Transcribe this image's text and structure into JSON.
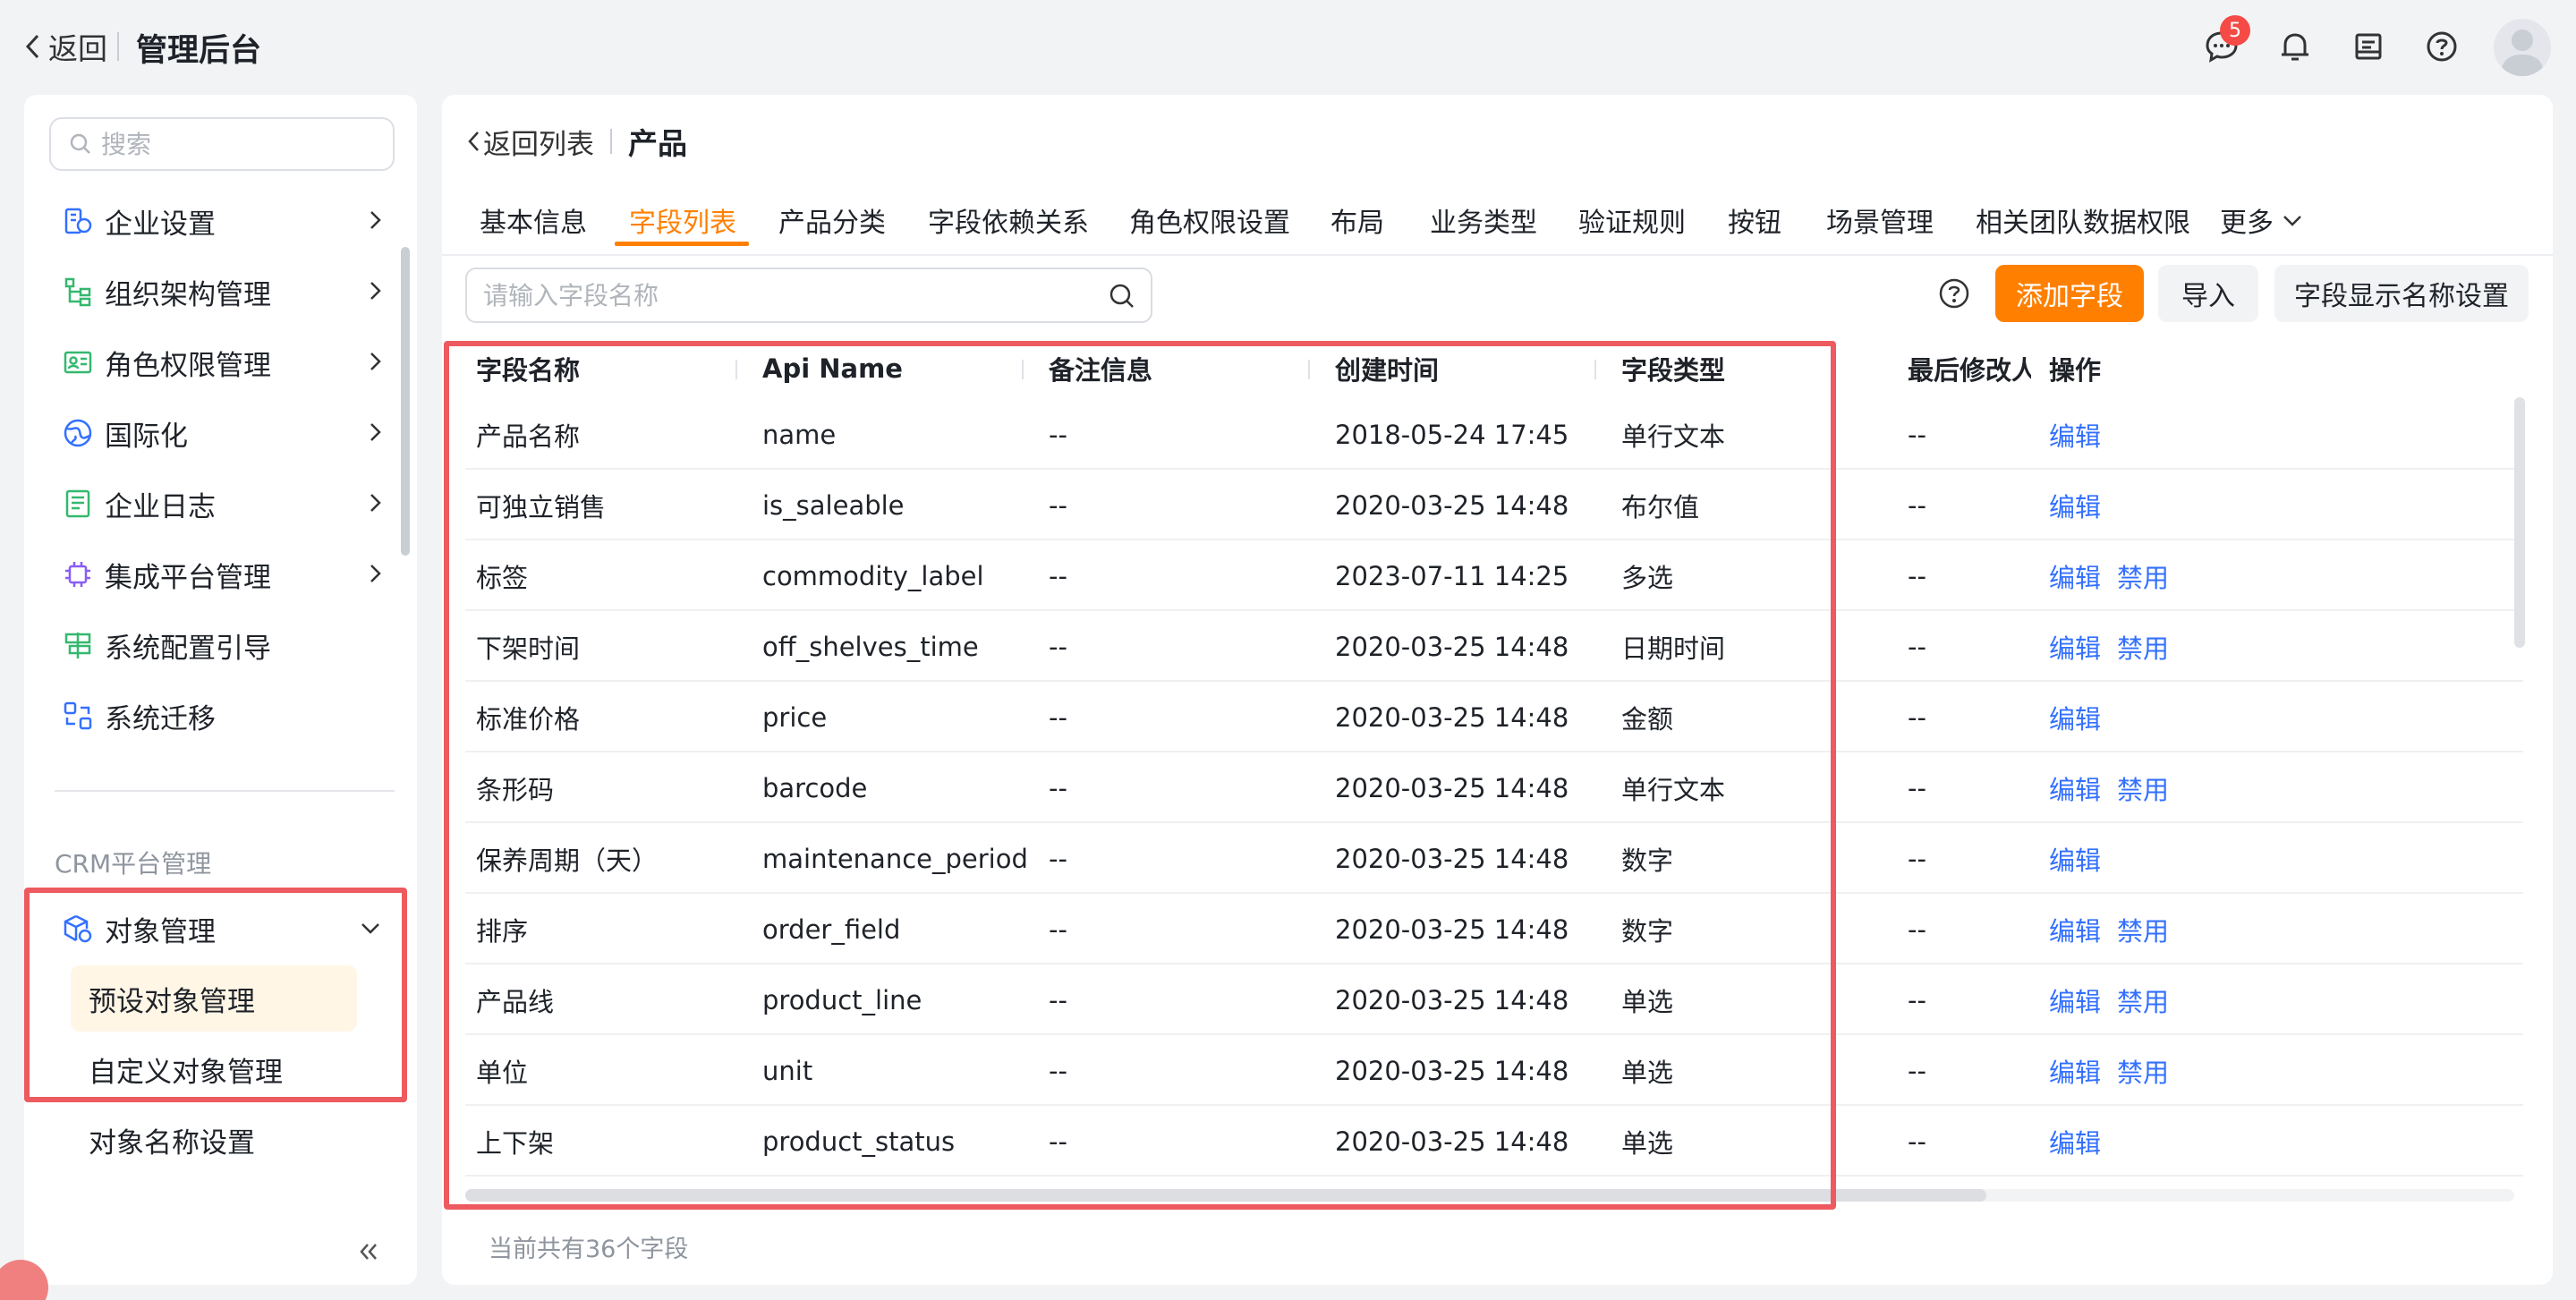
{
  "topbar": {
    "back_label": "返回",
    "title": "管理后台",
    "message_badge": "5",
    "icons": [
      "message-icon",
      "bell-icon",
      "notes-icon",
      "help-icon",
      "avatar"
    ]
  },
  "sidebar": {
    "search_placeholder": "搜索",
    "items": [
      {
        "label": "企业设置",
        "icon": "enterprise-settings-icon"
      },
      {
        "label": "组织架构管理",
        "icon": "org-structure-icon"
      },
      {
        "label": "角色权限管理",
        "icon": "role-permission-icon"
      },
      {
        "label": "国际化",
        "icon": "globe-icon"
      },
      {
        "label": "企业日志",
        "icon": "log-icon"
      },
      {
        "label": "集成平台管理",
        "icon": "chip-icon"
      },
      {
        "label": "系统配置引导",
        "icon": "signpost-icon"
      },
      {
        "label": "系统迁移",
        "icon": "migration-icon"
      }
    ],
    "section_label": "CRM平台管理",
    "object_mgmt": {
      "label": "对象管理",
      "sub_items": [
        "预设对象管理",
        "自定义对象管理"
      ]
    },
    "object_name_settings": "对象名称设置"
  },
  "main": {
    "breadcrumb": {
      "back": "返回列表",
      "current": "产品"
    },
    "tabs": [
      "基本信息",
      "字段列表",
      "产品分类",
      "字段依赖关系",
      "角色权限设置",
      "布局",
      "业务类型",
      "验证规则",
      "按钮",
      "场景管理",
      "相关团队数据权限",
      "更多"
    ],
    "active_tab": "字段列表",
    "field_search_placeholder": "请输入字段名称",
    "buttons": {
      "add_field": "添加字段",
      "import": "导入",
      "display_name_settings": "字段显示名称设置"
    },
    "table": {
      "columns": [
        "字段名称",
        "Api Name",
        "备注信息",
        "创建时间",
        "字段类型",
        "最后修改人",
        "操作"
      ],
      "rows": [
        {
          "name": "产品名称",
          "api": "name",
          "note": "--",
          "created": "2018-05-24 17:45",
          "type": "单行文本",
          "modifier": "--",
          "ops": [
            "编辑"
          ]
        },
        {
          "name": "可独立销售",
          "api": "is_saleable",
          "note": "--",
          "created": "2020-03-25 14:48",
          "type": "布尔值",
          "modifier": "--",
          "ops": [
            "编辑"
          ]
        },
        {
          "name": "标签",
          "api": "commodity_label",
          "note": "--",
          "created": "2023-07-11 14:25",
          "type": "多选",
          "modifier": "--",
          "ops": [
            "编辑",
            "禁用"
          ]
        },
        {
          "name": "下架时间",
          "api": "off_shelves_time",
          "note": "--",
          "created": "2020-03-25 14:48",
          "type": "日期时间",
          "modifier": "--",
          "ops": [
            "编辑",
            "禁用"
          ]
        },
        {
          "name": "标准价格",
          "api": "price",
          "note": "--",
          "created": "2020-03-25 14:48",
          "type": "金额",
          "modifier": "--",
          "ops": [
            "编辑"
          ]
        },
        {
          "name": "条形码",
          "api": "barcode",
          "note": "--",
          "created": "2020-03-25 14:48",
          "type": "单行文本",
          "modifier": "--",
          "ops": [
            "编辑",
            "禁用"
          ]
        },
        {
          "name": "保养周期（天）",
          "api": "maintenance_period",
          "note": "--",
          "created": "2020-03-25 14:48",
          "type": "数字",
          "modifier": "--",
          "ops": [
            "编辑"
          ]
        },
        {
          "name": "排序",
          "api": "order_field",
          "note": "--",
          "created": "2020-03-25 14:48",
          "type": "数字",
          "modifier": "--",
          "ops": [
            "编辑",
            "禁用"
          ]
        },
        {
          "name": "产品线",
          "api": "product_line",
          "note": "--",
          "created": "2020-03-25 14:48",
          "type": "单选",
          "modifier": "--",
          "ops": [
            "编辑",
            "禁用"
          ]
        },
        {
          "name": "单位",
          "api": "unit",
          "note": "--",
          "created": "2020-03-25 14:48",
          "type": "单选",
          "modifier": "--",
          "ops": [
            "编辑",
            "禁用"
          ]
        },
        {
          "name": "上下架",
          "api": "product_status",
          "note": "--",
          "created": "2020-03-25 14:48",
          "type": "单选",
          "modifier": "--",
          "ops": [
            "编辑"
          ]
        }
      ]
    },
    "footer": "当前共有36个字段"
  },
  "colors": {
    "accent": "#ff8000",
    "link": "#3370ff",
    "highlight_border": "#ed5a5f",
    "badge": "#f54a45"
  }
}
